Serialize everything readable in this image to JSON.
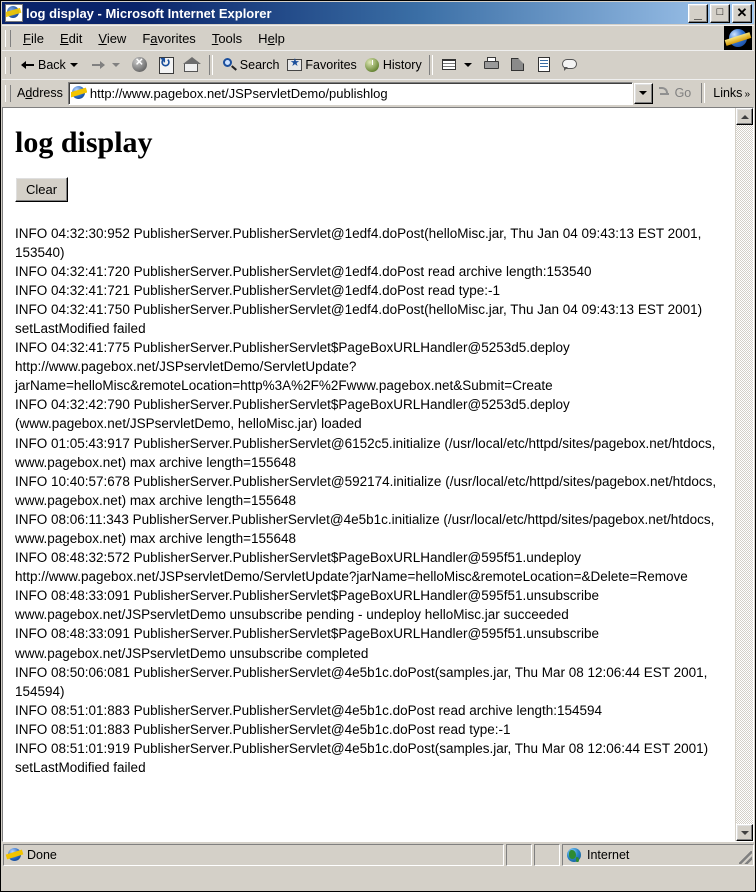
{
  "window": {
    "title": "log display - Microsoft Internet Explorer",
    "icon": "ie-document-icon",
    "minimize_label": "_",
    "maximize_label": "□",
    "close_label": "✕"
  },
  "menubar": {
    "items": [
      {
        "label": "File",
        "accel": "F"
      },
      {
        "label": "Edit",
        "accel": "E"
      },
      {
        "label": "View",
        "accel": "V"
      },
      {
        "label": "Favorites",
        "accel": "a"
      },
      {
        "label": "Tools",
        "accel": "T"
      },
      {
        "label": "Help",
        "accel": "H"
      }
    ]
  },
  "toolbar": {
    "back_label": "Back",
    "forward_label": "",
    "stop_label": "",
    "refresh_label": "",
    "home_label": "",
    "search_label": "Search",
    "favorites_label": "Favorites",
    "history_label": "History",
    "mail_label": "",
    "print_label": "",
    "edit_label": "",
    "related_label": "",
    "discuss_label": ""
  },
  "address": {
    "label": "Address",
    "value": "http://www.pagebox.net/JSPservletDemo/publishlog",
    "placeholder": "",
    "go_label": "Go",
    "links_label": "Links",
    "links_overflow": "»"
  },
  "page": {
    "heading": "log display",
    "clear_button": "Clear",
    "log_lines": [
      "INFO 04:32:30:952 PublisherServer.PublisherServlet@1edf4.doPost(helloMisc.jar, Thu Jan 04 09:43:13 EST 2001, 153540)",
      "INFO 04:32:41:720 PublisherServer.PublisherServlet@1edf4.doPost read archive length:153540",
      "INFO 04:32:41:721 PublisherServer.PublisherServlet@1edf4.doPost read type:-1",
      "INFO 04:32:41:750 PublisherServer.PublisherServlet@1edf4.doPost(helloMisc.jar, Thu Jan 04 09:43:13 EST 2001) setLastModified failed",
      "INFO 04:32:41:775 PublisherServer.PublisherServlet$PageBoxURLHandler@5253d5.deploy http://www.pagebox.net/JSPservletDemo/ServletUpdate?jarName=helloMisc&remoteLocation=http%3A%2F%2Fwww.pagebox.net&Submit=Create",
      "INFO 04:32:42:790 PublisherServer.PublisherServlet$PageBoxURLHandler@5253d5.deploy (www.pagebox.net/JSPservletDemo, helloMisc.jar) loaded",
      "INFO 01:05:43:917 PublisherServer.PublisherServlet@6152c5.initialize (/usr/local/etc/httpd/sites/pagebox.net/htdocs, www.pagebox.net) max archive length=155648",
      "INFO 10:40:57:678 PublisherServer.PublisherServlet@592174.initialize (/usr/local/etc/httpd/sites/pagebox.net/htdocs, www.pagebox.net) max archive length=155648",
      "INFO 08:06:11:343 PublisherServer.PublisherServlet@4e5b1c.initialize (/usr/local/etc/httpd/sites/pagebox.net/htdocs, www.pagebox.net) max archive length=155648",
      "INFO 08:48:32:572 PublisherServer.PublisherServlet$PageBoxURLHandler@595f51.undeploy http://www.pagebox.net/JSPservletDemo/ServletUpdate?jarName=helloMisc&remoteLocation=&Delete=Remove",
      "INFO 08:48:33:091 PublisherServer.PublisherServlet$PageBoxURLHandler@595f51.unsubscribe www.pagebox.net/JSPservletDemo unsubscribe pending - undeploy helloMisc.jar succeeded",
      "INFO 08:48:33:091 PublisherServer.PublisherServlet$PageBoxURLHandler@595f51.unsubscribe www.pagebox.net/JSPservletDemo unsubscribe completed",
      "INFO 08:50:06:081 PublisherServer.PublisherServlet@4e5b1c.doPost(samples.jar, Thu Mar 08 12:06:44 EST 2001, 154594)",
      "INFO 08:51:01:883 PublisherServer.PublisherServlet@4e5b1c.doPost read archive length:154594",
      "INFO 08:51:01:883 PublisherServer.PublisherServlet@4e5b1c.doPost read type:-1",
      "INFO 08:51:01:919 PublisherServer.PublisherServlet@4e5b1c.doPost(samples.jar, Thu Mar 08 12:06:44 EST 2001) setLastModified failed"
    ]
  },
  "scrollbar": {
    "up_arrow": "▲",
    "down_arrow": "▼"
  },
  "statusbar": {
    "status_text": "Done",
    "panel2": "",
    "panel3": "",
    "zone_text": "Internet"
  },
  "colors": {
    "titlebar_start": "#0A246A",
    "titlebar_end": "#A6CAF0",
    "chrome": "#D4D0C8",
    "page_bg": "#FFFFFF",
    "text": "#000000"
  }
}
